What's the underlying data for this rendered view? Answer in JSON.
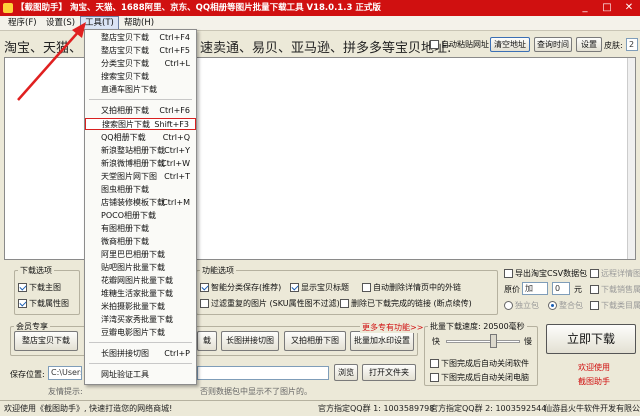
{
  "window": {
    "title": "【截图助手】 淘宝、天猫、1688阿里、京东、QQ相册等图片批量下载工具 V18.0.1.3 正式版",
    "minimize": "_",
    "maximize": "□",
    "close": "✕"
  },
  "menu": {
    "items": [
      {
        "label": "程序(F)"
      },
      {
        "label": "设置(S)"
      },
      {
        "label": "工具(T)"
      },
      {
        "label": "帮助(H)"
      }
    ]
  },
  "url_row": {
    "prompt": "淘宝、天猫、",
    "prompt_tail": "速卖通、易贝、亚马逊、拼多多等宝贝地址:",
    "auto_paste": "自动粘贴网址",
    "clear_button": "清空地址",
    "query_button": "查询时间",
    "settings_button": "设置",
    "skin_label": "皮肤:",
    "skin_value": "2"
  },
  "tools_menu": [
    {
      "label": "整店宝贝下载",
      "shortcut": "Ctrl+F4"
    },
    {
      "label": "整店宝贝下载",
      "shortcut": "Ctrl+F5"
    },
    {
      "label": "分类宝贝下载",
      "shortcut": "Ctrl+L"
    },
    {
      "label": "搜索宝贝下载",
      "shortcut": ""
    },
    {
      "label": "直通车图片下载",
      "shortcut": ""
    },
    {
      "label": "又拍相册下载",
      "shortcut": "Ctrl+F6"
    },
    {
      "label": "搜索图片下载",
      "shortcut": "Shift+F3"
    },
    {
      "label": "QQ相册下载",
      "shortcut": "Ctrl+Q"
    },
    {
      "label": "新浪整站相册下载",
      "shortcut": "Ctrl+Y"
    },
    {
      "label": "新浪微博相册下载",
      "shortcut": "Ctrl+W"
    },
    {
      "label": "天堂图片网下图",
      "shortcut": "Ctrl+T"
    },
    {
      "label": "图虫相册下载",
      "shortcut": ""
    },
    {
      "label": "店铺装修模板下载",
      "shortcut": "Ctrl+M"
    },
    {
      "label": "POCO相册下载",
      "shortcut": ""
    },
    {
      "label": "有图相册下载",
      "shortcut": ""
    },
    {
      "label": "微商相册下载",
      "shortcut": ""
    },
    {
      "label": "阿里巴巴相册下载",
      "shortcut": ""
    },
    {
      "label": "贴吧图片批量下载",
      "shortcut": ""
    },
    {
      "label": "花瓣网图片批量下载",
      "shortcut": ""
    },
    {
      "label": "堆糖生活家批量下载",
      "shortcut": ""
    },
    {
      "label": "米拍摄影批量下载",
      "shortcut": ""
    },
    {
      "label": "洋湾买家秀批量下载",
      "shortcut": ""
    },
    {
      "label": "豆瓣电影图片下载",
      "shortcut": ""
    },
    {
      "label": "长图拼接切图",
      "shortcut": "Ctrl+P"
    },
    {
      "label": "网址验证工具",
      "shortcut": ""
    }
  ],
  "download_options": {
    "title": "下载选项",
    "main_img": "下载主图",
    "attr_img": "下载属性图"
  },
  "function_options": {
    "title": "功能选项",
    "smart_classify": "智能分类保存(推荐)",
    "show_title": "显示宝贝标题",
    "auto_delete": "自动删除详情页中的外链",
    "filter_dup": "过滤重复的图片 (SKU属性图不过滤)",
    "delete_link": "删除已下载完成的链接 (断点续传)",
    "more": "更多专有功能>>"
  },
  "right_options": {
    "export_csv": "导出淘宝CSV数据包",
    "remote_detail": "远程详情图",
    "price_label": "原价",
    "price_value": "加",
    "price_num": "0",
    "price_unit": "元",
    "sales_price": "下载销售属性",
    "independent": "独立包",
    "merge": "整合包",
    "sales_attr": "下载类目属性"
  },
  "member": {
    "title": "会员专享",
    "btn_whole_store": "整店宝贝下载",
    "btn_gap": "载",
    "btn_long_img": "长图拼接切图",
    "btn_youpai": "又拍相册下图",
    "btn_batch_watermark": "批量加水印设置"
  },
  "speed": {
    "title": "批量下载速度: 20500毫秒",
    "fast": "快",
    "slow": "慢",
    "auto_close": "下图完成后自动关闭软件",
    "auto_shutdown": "下图完成后自动关闭电脑"
  },
  "save": {
    "label": "保存位置:",
    "path": "C:\\Users",
    "browse": "浏览",
    "open_folder": "打开文件夹",
    "hint": "友情提示:",
    "hint_tail": "否则数据包中显示不了图片的。"
  },
  "download_button": "立即下载",
  "welcome": {
    "line1": "欢迎使用",
    "line2": "截图助手"
  },
  "status": {
    "welcome": "欢迎使用《截图助手》, 快速打造您的网络商城!",
    "qq1": "官方指定QQ群 1: 1003589798",
    "qq2": "官方指定QQ群 2: 1003592544",
    "company": "仙游县火牛软件开发有限公司"
  }
}
